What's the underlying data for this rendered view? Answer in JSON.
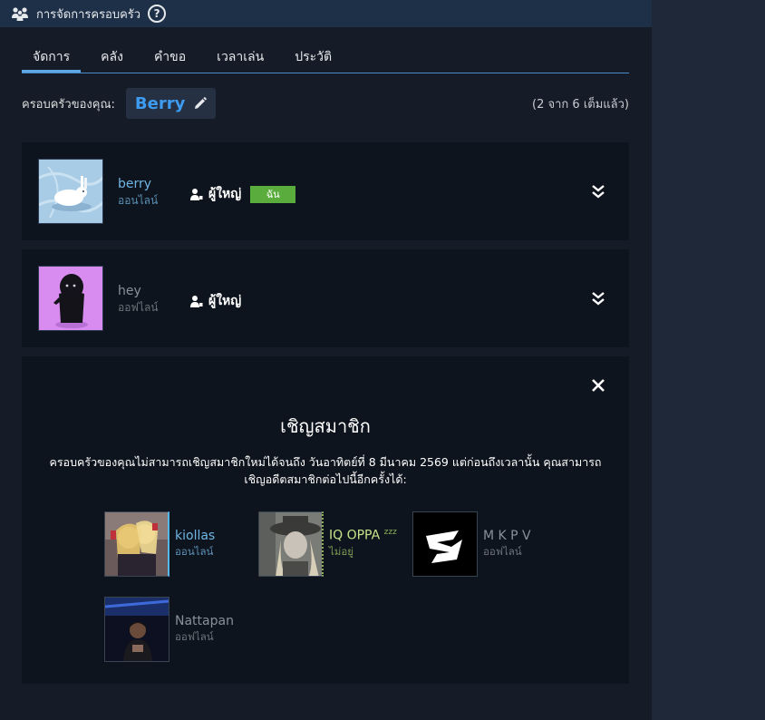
{
  "header": {
    "title": "การจัดการครอบครัว",
    "help": "?",
    "icon": "family-icon"
  },
  "tabs": [
    {
      "label": "จัดการ",
      "active": true
    },
    {
      "label": "คลัง",
      "active": false
    },
    {
      "label": "คำขอ",
      "active": false
    },
    {
      "label": "เวลาเล่น",
      "active": false
    },
    {
      "label": "ประวัติ",
      "active": false
    }
  ],
  "family": {
    "label": "ครอบครัวของคุณ:",
    "name": "Berry",
    "count": "(2 จาก 6 เต็มแล้ว)"
  },
  "members": [
    {
      "name": "berry",
      "status": "ออนไลน์",
      "role": "ผู้ใหญ่",
      "badge": "ฉัน"
    },
    {
      "name": "hey",
      "status": "ออฟไลน์",
      "role": "ผู้ใหญ่"
    }
  ],
  "invite": {
    "title": "เชิญสมาชิก",
    "text": "ครอบครัวของคุณไม่สามารถเชิญสมาชิกใหม่ได้จนถึง วันอาทิตย์ที่ 8 มีนาคม 2569 แต่ก่อนถึงเวลานั้น คุณสามารถเชิญอดีตสมาชิกต่อไปนี้อีกครั้งได้:",
    "friends": [
      {
        "name": "kiollas",
        "status": "ออนไลน์"
      },
      {
        "name": "IQ OPPA",
        "status": "ไม่อยู่",
        "zzz": "zzz"
      },
      {
        "name": "M K P V",
        "status": "ออฟไลน์"
      },
      {
        "name": "Nattapan",
        "status": "ออฟไลน์"
      }
    ]
  },
  "colors": {
    "accent": "#3d9bf0",
    "online": "#6fb5e4",
    "away": "#c6e389",
    "badge": "#5aad3c"
  }
}
